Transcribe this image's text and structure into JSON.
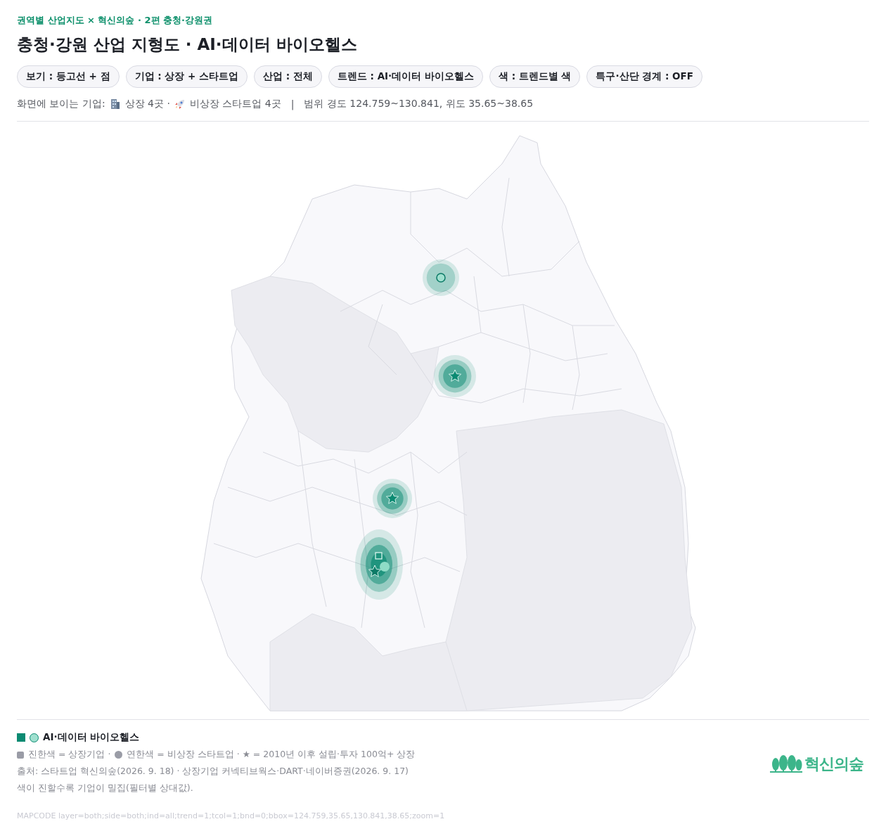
{
  "header": {
    "eyebrow": "권역별 산업지도 × 혁신의숲 · 2편 충청·강원권",
    "title": "충청·강원 산업 지형도 · AI·데이터 바이오헬스"
  },
  "filters": [
    {
      "label": "보기 : 등고선 + 점"
    },
    {
      "label": "기업 : 상장 + 스타트업"
    },
    {
      "label": "산업 : 전체"
    },
    {
      "label": "트렌드 : AI·데이터 바이오헬스"
    },
    {
      "label": "색 : 트렌드별 색"
    },
    {
      "label": "특구·산단 경계 : OFF"
    }
  ],
  "summary": {
    "prefix": "화면에 보이는 기업:",
    "listed": "상장 4곳 ·",
    "startups": "비상장 스타트업 4곳",
    "separator": "|",
    "range": "범위 경도 124.759~130.841, 위도 35.65~38.65"
  },
  "legend": {
    "trend": {
      "label": "AI·데이터 바이오헬스",
      "color": "#0b8a72"
    },
    "key_listed": "진한색 = 상장기업 ·",
    "key_startup": "연한색 = 비상장 스타트업 · ★ = 2010년 이후 설립·투자 100억+ 상장",
    "notes": [
      "출처: 스타트업 혁신의숲(2026. 9. 18) · 상장기업 커넥티브웍스·DART·네이버증권(2026. 9. 17)",
      "색이 진할수록 기업이 밀집(필터별 상대값)."
    ],
    "code": "MAPCODE layer=both;side=both;ind=all;trend=1;tcol=1;bnd=0;bbox=124.759,35.65,130.841,38.65;zoom=1"
  },
  "logo": {
    "text": "혁신의숲"
  }
}
